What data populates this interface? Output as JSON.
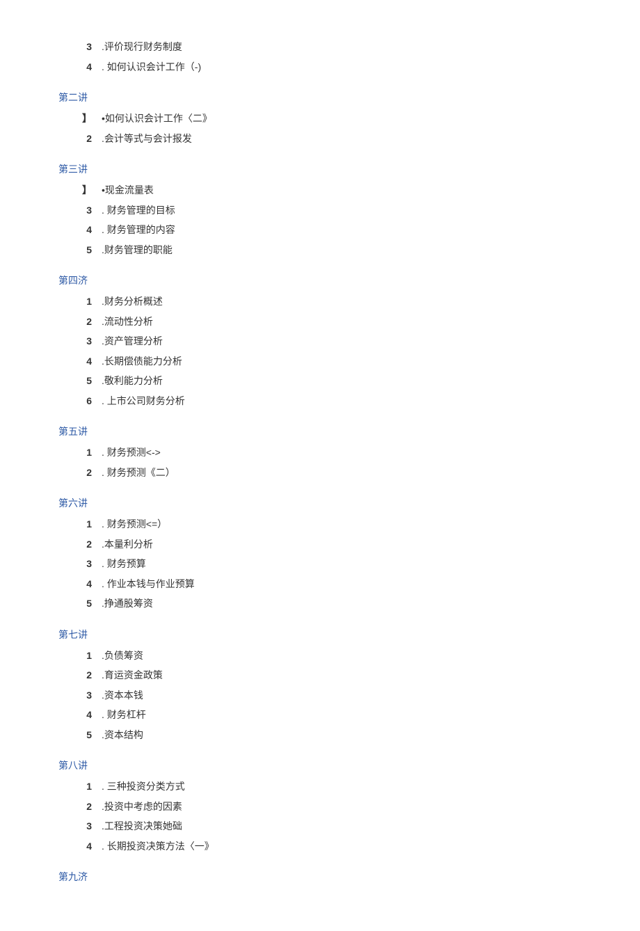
{
  "sections": [
    {
      "title": null,
      "items": [
        {
          "num": "3",
          "text": ".评价现行财务制度"
        },
        {
          "num": "4",
          "text": ". 如何认识会计工作（-)"
        }
      ]
    },
    {
      "title": "第二讲",
      "items": [
        {
          "num": "】",
          "text": "•如何认识会计工作〈二》"
        },
        {
          "num": "2",
          "text": ".会计等式与会计报发"
        }
      ]
    },
    {
      "title": "第三讲",
      "items": [
        {
          "num": "】",
          "text": "•现金流量表"
        },
        {
          "num": "3",
          "text": ". 财务管理的目标"
        },
        {
          "num": "4",
          "text": ". 财务管理的内容"
        },
        {
          "num": "5",
          "text": ".财务管理的职能"
        }
      ]
    },
    {
      "title": "第四济",
      "items": [
        {
          "num": "1",
          "text": ".财务分析概述"
        },
        {
          "num": "2",
          "text": ".流动性分析"
        },
        {
          "num": "3",
          "text": ".资产管理分析"
        },
        {
          "num": "4",
          "text": ".长期偿债能力分析"
        },
        {
          "num": "5",
          "text": ".敬利能力分析"
        },
        {
          "num": "6",
          "text": ". 上市公司财务分析"
        }
      ]
    },
    {
      "title": "第五讲",
      "items": [
        {
          "num": "1",
          "text": ". 财务预测<->"
        },
        {
          "num": "2",
          "text": ". 财务预测《二）"
        }
      ]
    },
    {
      "title": "第六讲",
      "items": [
        {
          "num": "1",
          "text": ". 财务预测<=）"
        },
        {
          "num": "2",
          "text": ".本量利分析"
        },
        {
          "num": "3",
          "text": ". 财务预算"
        },
        {
          "num": "4",
          "text": ". 作业本钱与作业预算"
        },
        {
          "num": "5",
          "text": ".挣通股筹资"
        }
      ]
    },
    {
      "title": "第七讲",
      "items": [
        {
          "num": "1",
          "text": ".负债筹资"
        },
        {
          "num": "2",
          "text": ".育运资金政策"
        },
        {
          "num": "3",
          "text": ".资本本钱"
        },
        {
          "num": "4",
          "text": ". 财务杠杆"
        },
        {
          "num": "5",
          "text": ".资本结构"
        }
      ]
    },
    {
      "title": "第八讲",
      "items": [
        {
          "num": "1",
          "text": ". 三种投资分类方式"
        },
        {
          "num": "2",
          "text": ".投资中考虑的因素"
        },
        {
          "num": "3",
          "text": ".工程投资决策她础"
        },
        {
          "num": "4",
          "text": ". 长期投资决策方法〈一》"
        }
      ]
    },
    {
      "title": "第九济",
      "items": []
    }
  ]
}
